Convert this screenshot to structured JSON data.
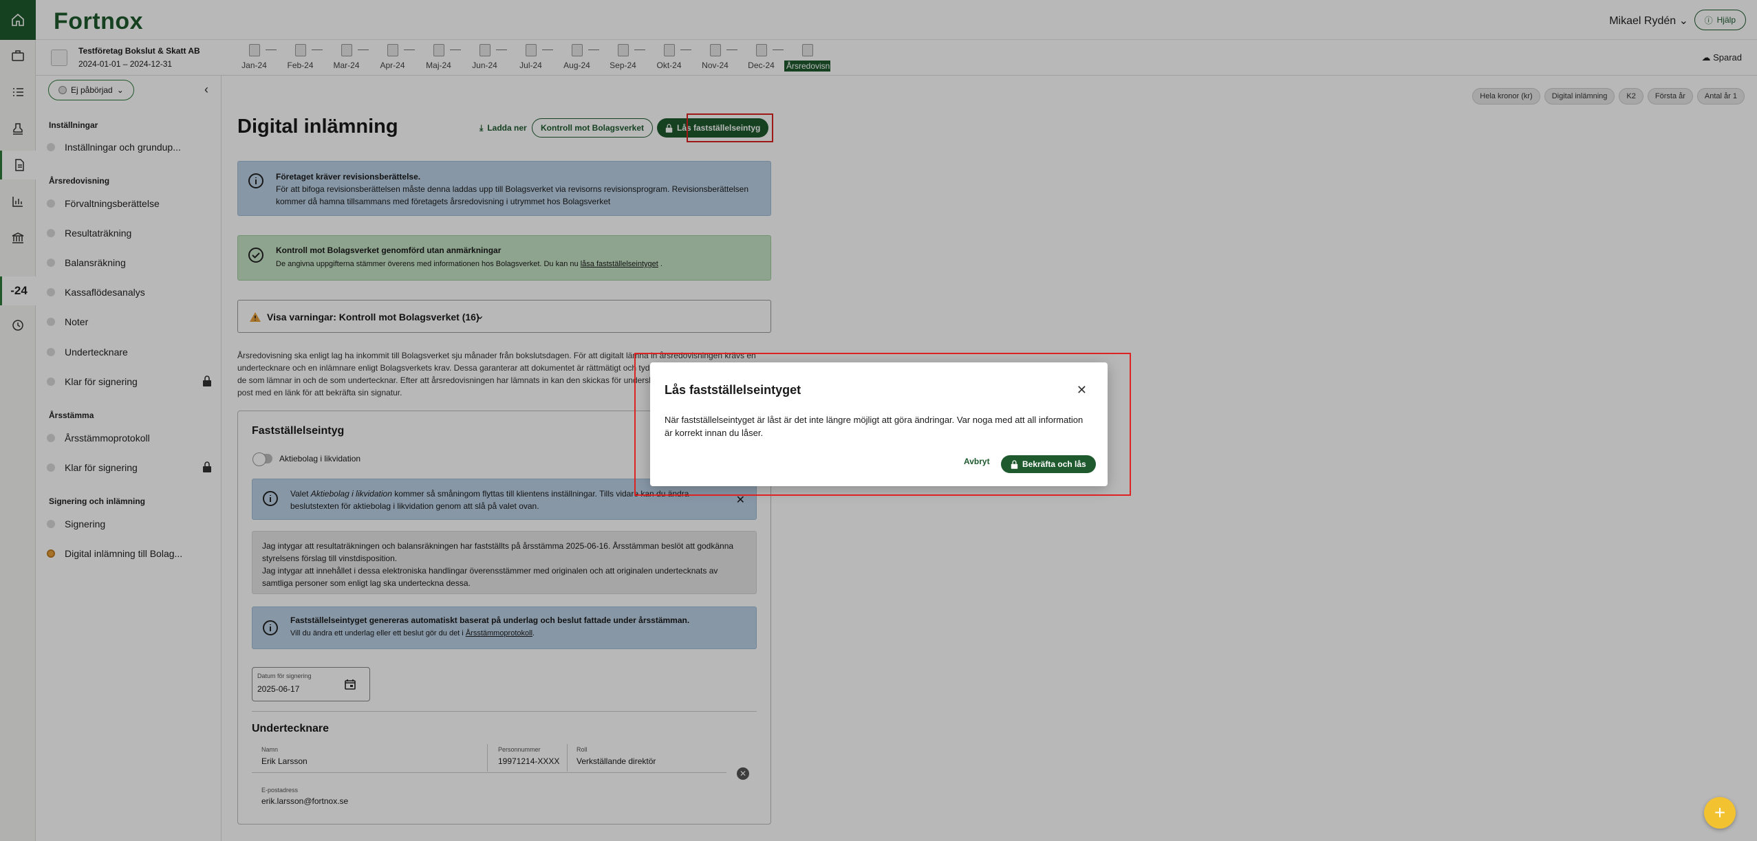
{
  "header": {
    "logo": "Fortnox",
    "user": "Mikael Rydén",
    "help": "Hjälp"
  },
  "subheader": {
    "company": "Testföretag Bokslut & Skatt AB",
    "period": "2024-01-01 – 2024-12-31",
    "months": [
      "Jan-24",
      "Feb-24",
      "Mar-24",
      "Apr-24",
      "Maj-24",
      "Jun-24",
      "Jul-24",
      "Aug-24",
      "Sep-24",
      "Okt-24",
      "Nov-24",
      "Dec-24",
      "Årsredovisning"
    ],
    "saved": "Sparad"
  },
  "rail": {
    "year": "-24"
  },
  "sidebar": {
    "status": "Ej påbörjad",
    "sections": [
      {
        "title": "Inställningar",
        "items": [
          "Inställningar och grundup..."
        ]
      },
      {
        "title": "Årsredovisning",
        "items": [
          "Förvaltningsberättelse",
          "Resultaträkning",
          "Balansräkning",
          "Kassaflödesanalys",
          "Noter",
          "Undertecknare",
          "Klar för signering"
        ]
      },
      {
        "title": "Årsstämma",
        "items": [
          "Årsstämmoprotokoll",
          "Klar för signering"
        ]
      },
      {
        "title": "Signering och inlämning",
        "items": [
          "Signering",
          "Digital inlämning till Bolag..."
        ]
      }
    ]
  },
  "main": {
    "title": "Digital inlämning",
    "load": "Ladda ner",
    "control": "Kontroll mot Bolagsverket",
    "lock": "Lås fastställelseintyg",
    "info1_title": "Företaget kräver revisionsberättelse.",
    "info1_text": "För att bifoga revisionsberättelsen måste denna laddas upp till Bolagsverket via revisorns revisionsprogram. Revisionsberättelsen kommer då hamna tillsammans med företagets årsredovisning i utrymmet hos Bolagsverket",
    "ok_title": "Kontroll mot Bolagsverket genomförd utan anmärkningar",
    "ok_text": "De angivna uppgifterna stämmer överens med informationen hos Bolagsverket. Du kan nu",
    "ok_link": "låsa fastställelseintyget",
    "ok_end": ".",
    "warnings": "Visa varningar: Kontroll mot Bolagsverket (16)",
    "para": "Årsredovisning ska enligt lag ha inkommit till Bolagsverket sju månader från bokslutsdagen. För att digitalt lämna in årsredovisningen krävs en undertecknare och en inlämnare enligt Bolagsverkets krav. Dessa garanterar att dokumentet är rättmätigt och tydliggör ansvarsfördelning mellan de som lämnar in och de som undertecknar. Efter att årsredovisningen har lämnats in kan den skickas för underskrift. Undertecknaren får en e-post med en länk för att bekräfta sin signatur.",
    "card": {
      "title": "Fastställelseintyg",
      "toggle": "Aktiebolag i likvidation",
      "info_pre": "Valet ",
      "info_em": "Aktiebolag i likvidation",
      "info_post": " kommer så småningom flyttas till klientens inställningar. Tills vidare kan du ändra beslutstexten för aktiebolag i likvidation genom att slå på valet ovan.",
      "cert1": "Jag intygar att resultaträkningen och balansräkningen har fastställts på årsstämma 2025-06-16. Årsstämman beslöt att godkänna styrelsens förslag till vinstdisposition.",
      "cert2": "Jag intygar att innehållet i dessa elektroniska handlingar överensstämmer med originalen och att originalen undertecknats av samtliga personer som enligt lag ska underteckna dessa.",
      "auto_title": "Fastställelseintyget genereras automatiskt baserat på underlag och beslut fattade under årsstämman.",
      "auto_text": "Vill du ändra ett underlag eller ett beslut gör du det i",
      "auto_link": "Årsstämmoprotokoll",
      "auto_end": ".",
      "date_label": "Datum för signering",
      "date_value": "2025-06-17",
      "signer_title": "Undertecknare",
      "name_label": "Namn",
      "name": "Erik Larsson",
      "pnr_label": "Personnummer",
      "pnr": "19971214-XXXX",
      "role_label": "Roll",
      "role": "Verkställande direktör",
      "email_label": "E-postadress",
      "email": "erik.larsson@fortnox.se"
    }
  },
  "chips": [
    "Hela kronor (kr)",
    "Digital inlämning",
    "K2",
    "Första år",
    "Antal år 1"
  ],
  "modal": {
    "title": "Lås fastställelseintyget",
    "text": "När fastställelseintyget är låst är det inte längre möjligt att göra ändringar. Var noga med att all information är korrekt innan du låser.",
    "cancel": "Avbryt",
    "confirm": "Bekräfta och lås"
  },
  "colors": {
    "brand": "#1e5a2e",
    "highlight": "#dd2222",
    "info": "#bcd2e6",
    "success": "#c7e3c7",
    "fab": "#f2c230"
  }
}
